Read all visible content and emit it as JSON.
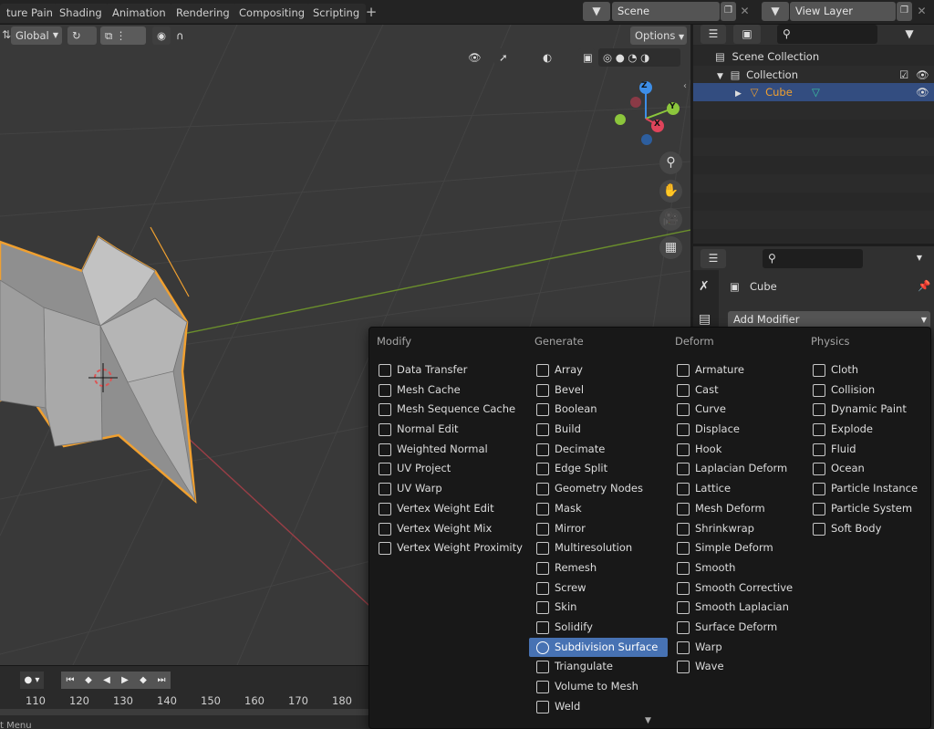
{
  "topbar": {
    "tabs": [
      "ture Paint",
      "Shading",
      "Animation",
      "Rendering",
      "Compositing",
      "Scripting"
    ],
    "scene_label": "Scene",
    "view_layer_label": "View Layer"
  },
  "viewport": {
    "orientation": "Global",
    "options_label": "Options",
    "axes": {
      "z": "Z",
      "y": "Y",
      "x": "X"
    }
  },
  "timeline": {
    "ticks": [
      "110",
      "120",
      "130",
      "140",
      "150",
      "160",
      "170",
      "180"
    ],
    "status_text": "t Menu"
  },
  "outliner": {
    "scene_collection": "Scene Collection",
    "collection": "Collection",
    "object": "Cube"
  },
  "properties": {
    "object_name": "Cube",
    "add_modifier_label": "Add Modifier"
  },
  "menu": {
    "columns": [
      {
        "header": "Modify",
        "items": [
          "Data Transfer",
          "Mesh Cache",
          "Mesh Sequence Cache",
          "Normal Edit",
          "Weighted Normal",
          "UV Project",
          "UV Warp",
          "Vertex Weight Edit",
          "Vertex Weight Mix",
          "Vertex Weight Proximity"
        ]
      },
      {
        "header": "Generate",
        "items": [
          "Array",
          "Bevel",
          "Boolean",
          "Build",
          "Decimate",
          "Edge Split",
          "Geometry Nodes",
          "Mask",
          "Mirror",
          "Multiresolution",
          "Remesh",
          "Screw",
          "Skin",
          "Solidify",
          "Subdivision Surface",
          "Triangulate",
          "Volume to Mesh",
          "Weld"
        ]
      },
      {
        "header": "Deform",
        "items": [
          "Armature",
          "Cast",
          "Curve",
          "Displace",
          "Hook",
          "Laplacian Deform",
          "Lattice",
          "Mesh Deform",
          "Shrinkwrap",
          "Simple Deform",
          "Smooth",
          "Smooth Corrective",
          "Smooth Laplacian",
          "Surface Deform",
          "Warp",
          "Wave"
        ]
      },
      {
        "header": "Physics",
        "items": [
          "Cloth",
          "Collision",
          "Dynamic Paint",
          "Explode",
          "Fluid",
          "Ocean",
          "Particle Instance",
          "Particle System",
          "Soft Body"
        ]
      }
    ],
    "highlighted": "Subdivision Surface"
  },
  "colors": {
    "selection": "#4772b3",
    "object_outline": "#f0a030",
    "x_axis": "#e0445b",
    "y_axis": "#8cc63c",
    "z_axis": "#3d8ee8"
  }
}
